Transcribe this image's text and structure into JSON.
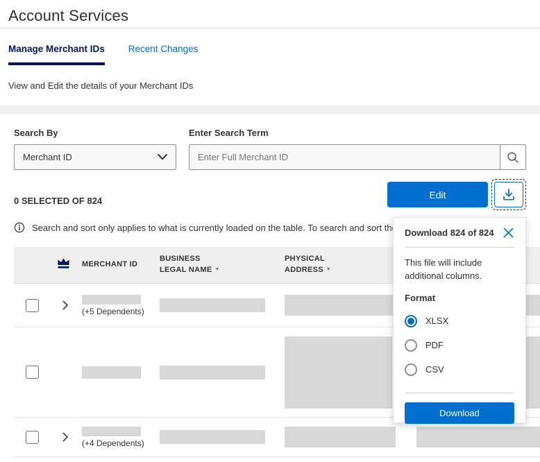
{
  "page": {
    "title": "Account Services",
    "subtitle": "View and Edit the details of your Merchant IDs"
  },
  "tabs": [
    {
      "label": "Manage Merchant IDs",
      "active": true
    },
    {
      "label": "Recent Changes",
      "active": false
    }
  ],
  "search": {
    "search_by_label": "Search By",
    "search_by_value": "Merchant ID",
    "term_label": "Enter Search Term",
    "term_placeholder": "Enter Full Merchant ID"
  },
  "toolbar": {
    "selected_text": "0 SELECTED OF 824",
    "edit_label": "Edit",
    "info_text": "Search and sort only applies to what is currently loaded on the table. To search and sort the entire"
  },
  "table": {
    "columns": {
      "merchant_id": "MERCHANT ID",
      "business_legal_name": "BUSINESS LEGAL NAME",
      "physical_address": "PHYSICAL ADDRESS"
    },
    "rows": [
      {
        "dependents": "(+5 Dependents)"
      },
      {
        "dependents": ""
      },
      {
        "dependents": "(+4 Dependents)"
      }
    ]
  },
  "download_popup": {
    "title": "Download 824 of 824",
    "body": "This file will include additional columns.",
    "format_label": "Format",
    "formats": [
      {
        "label": "XLSX",
        "selected": true
      },
      {
        "label": "PDF",
        "selected": false
      },
      {
        "label": "CSV",
        "selected": false
      }
    ],
    "download_label": "Download"
  },
  "colors": {
    "brand_blue": "#006fcf",
    "deep_navy": "#00175a",
    "placeholder_bar": "#d8d8d8"
  }
}
